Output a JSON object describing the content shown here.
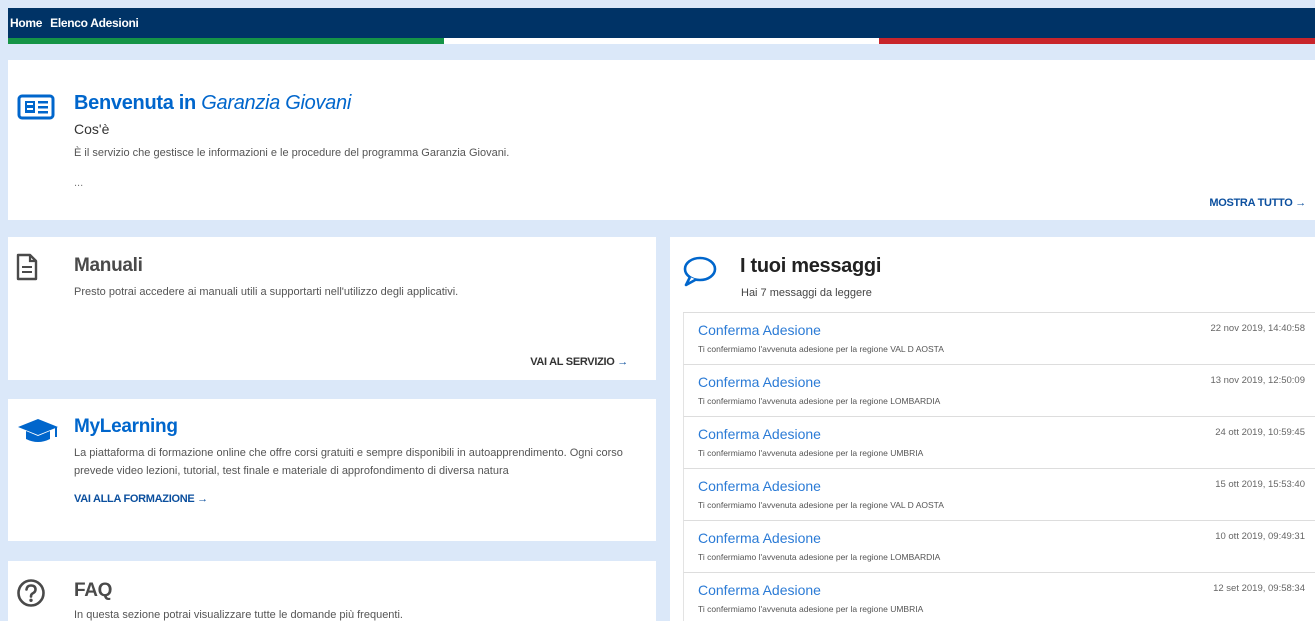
{
  "nav": {
    "home": "Home",
    "elenco": "Elenco Adesioni"
  },
  "colors": {
    "nav_bg": "#003366",
    "flag_green": "#159447",
    "flag_white": "#ffffff",
    "flag_red": "#c8252b",
    "accent": "#0066cc",
    "page_bg": "#dbe8f9"
  },
  "welcome": {
    "title_prefix": "Benvenuta in",
    "title_italic": "Garanzia Giovani",
    "subtitle": "Cos'è",
    "description": "È il servizio che gestisce le informazioni e le procedure del programma Garanzia Giovani.",
    "ellipsis": "...",
    "more_label": "MOSTRA TUTTO",
    "icon": "newspaper-icon"
  },
  "manuali": {
    "title": "Manuali",
    "text": "Presto potrai accedere ai manuali utili a supportarti nell'utilizzo degli applicativi.",
    "link": "VAI AL SERVIZIO",
    "icon": "document-icon"
  },
  "mylearning": {
    "title": "MyLearning",
    "text": "La piattaforma di formazione online che offre corsi gratuiti e sempre disponibili in autoapprendimento. Ogni corso prevede video lezioni, tutorial, test finale e materiale di approfondimento di diversa natura",
    "link": "VAI ALLA FORMAZIONE",
    "icon": "graduation-cap-icon"
  },
  "faq": {
    "title": "FAQ",
    "text": "In questa sezione potrai visualizzare tutte le domande più frequenti.",
    "icon": "question-circle-icon"
  },
  "messages": {
    "title": "I tuoi messaggi",
    "count_text": "Hai 7 messaggi da leggere",
    "icon": "speech-bubble-icon",
    "items": [
      {
        "title": "Conferma Adesione",
        "body": "Ti confermiamo l'avvenuta adesione per la regione VAL D AOSTA",
        "date": "22 nov 2019, 14:40:58"
      },
      {
        "title": "Conferma Adesione",
        "body": "Ti confermiamo l'avvenuta adesione per la regione LOMBARDIA",
        "date": "13 nov 2019, 12:50:09"
      },
      {
        "title": "Conferma Adesione",
        "body": "Ti confermiamo l'avvenuta adesione per la regione UMBRIA",
        "date": "24 ott 2019, 10:59:45"
      },
      {
        "title": "Conferma Adesione",
        "body": "Ti confermiamo l'avvenuta adesione per la regione VAL D AOSTA",
        "date": "15 ott 2019, 15:53:40"
      },
      {
        "title": "Conferma Adesione",
        "body": "Ti confermiamo l'avvenuta adesione per la regione LOMBARDIA",
        "date": "10 ott 2019, 09:49:31"
      },
      {
        "title": "Conferma Adesione",
        "body": "Ti confermiamo l'avvenuta adesione per la regione UMBRIA",
        "date": "12 set 2019, 09:58:34"
      }
    ]
  }
}
